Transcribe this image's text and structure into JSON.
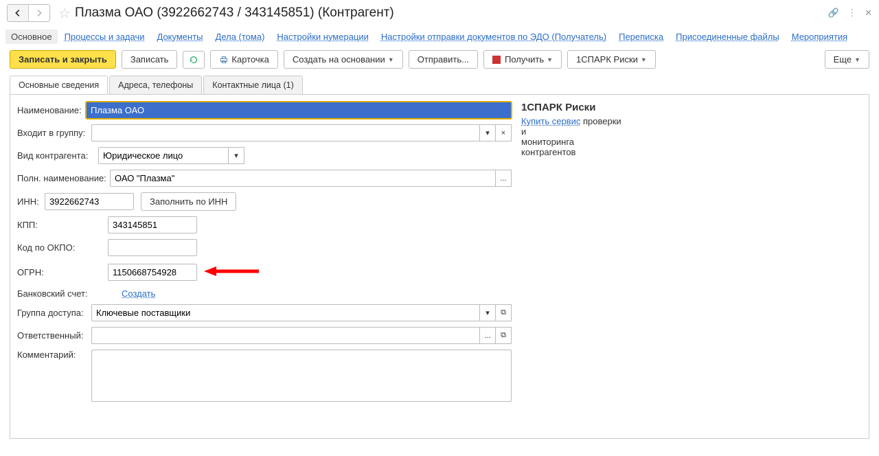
{
  "title": "Плазма ОАО (3922662743 / 343145851) (Контрагент)",
  "nav": {
    "items": [
      "Основное",
      "Процессы и задачи",
      "Документы",
      "Дела (тома)",
      "Настройки нумерации",
      "Настройки отправки документов по ЭДО (Получатель)",
      "Переписка",
      "Присоединенные файлы",
      "Мероприятия"
    ]
  },
  "toolbar": {
    "save_close": "Записать и закрыть",
    "save": "Записать",
    "card": "Карточка",
    "create_based": "Создать на основании",
    "send": "Отправить...",
    "receive": "Получить",
    "spark": "1СПАРК Риски",
    "more": "Еще"
  },
  "tabs": [
    "Основные сведения",
    "Адреса, телефоны",
    "Контактные лица (1)"
  ],
  "form": {
    "label_name": "Наименование:",
    "name": "Плазма ОАО",
    "label_group": "Входит в группу:",
    "group": "",
    "label_type": "Вид контрагента:",
    "type": "Юридическое лицо",
    "label_fullname": "Полн. наименование:",
    "fullname": "ОАО \"Плазма\"",
    "label_inn": "ИНН:",
    "inn": "3922662743",
    "fill_by_inn": "Заполнить по ИНН",
    "label_kpp": "КПП:",
    "kpp": "343145851",
    "label_okpo": "Код по ОКПО:",
    "okpo": "",
    "label_ogrn": "ОГРН:",
    "ogrn": "1150668754928",
    "label_bank": "Банковский счет:",
    "bank_create": "Создать",
    "label_access": "Группа доступа:",
    "access": "Ключевые поставщики",
    "label_resp": "Ответственный:",
    "resp": "",
    "label_comment": "Комментарий:",
    "comment": ""
  },
  "side": {
    "head": "1СПАРК Риски",
    "buy": "Купить сервис",
    "text1": "проверки",
    "text2": "и",
    "text3": "мониторинга",
    "text4": "контрагентов"
  }
}
